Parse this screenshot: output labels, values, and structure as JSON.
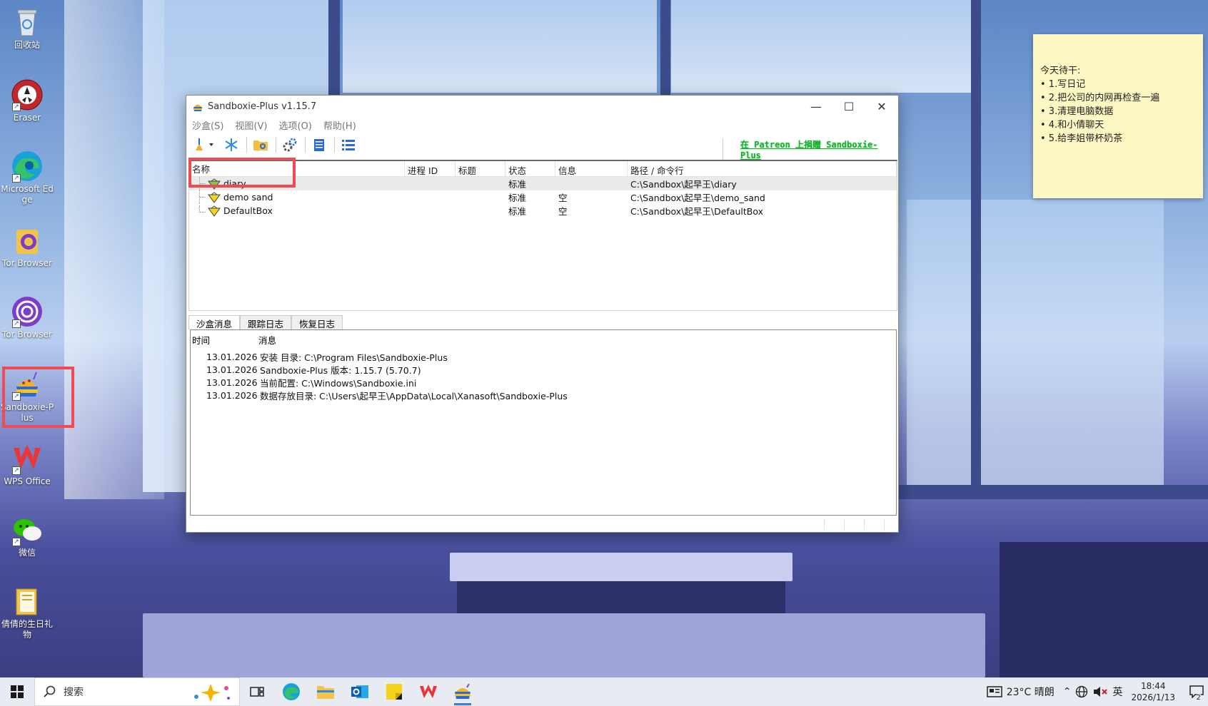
{
  "desktop": {
    "icons": [
      {
        "label": "回收站",
        "icon": "recycle-bin-icon"
      },
      {
        "label": "Eraser",
        "icon": "eraser-icon"
      },
      {
        "label": "Microsoft Edge",
        "icon": "edge-icon"
      },
      {
        "label": "Tor Browser",
        "icon": "tor-folder-icon"
      },
      {
        "label": "Tor Browser",
        "icon": "tor-browser-icon"
      },
      {
        "label": "Sandboxie-Plus",
        "icon": "sandboxie-icon"
      },
      {
        "label": "WPS Office",
        "icon": "wps-icon"
      },
      {
        "label": "微信",
        "icon": "wechat-icon"
      },
      {
        "label": "倩倩的生日礼物",
        "icon": "folder-icon"
      }
    ]
  },
  "sticky_note": {
    "title": "今天待干:",
    "items": [
      "• 1.写日记",
      "• 2.把公司的内网再检查一遍",
      "• 3.清理电脑数据",
      "• 4.和小倩聊天",
      "• 5.给李姐带杯奶茶"
    ]
  },
  "window": {
    "title": "Sandboxie-Plus v1.15.7",
    "menu": [
      "沙盒(S)",
      "视图(V)",
      "选项(O)",
      "帮助(H)"
    ],
    "patreon_link": "在 Patreon 上捐赠 Sandboxie-Plus",
    "columns": [
      "名称",
      "进程 ID",
      "标题",
      "状态",
      "信息",
      "路径 / 命令行"
    ],
    "boxes": [
      {
        "name": "diary",
        "pid": "",
        "title": "",
        "state": "标准",
        "info": "",
        "path": "C:\\Sandbox\\起早王\\diary",
        "color": "#8cc63f"
      },
      {
        "name": "demo sand",
        "pid": "",
        "title": "",
        "state": "标准",
        "info": "空",
        "path": "C:\\Sandbox\\起早王\\demo_sand",
        "color": "#f5d31a"
      },
      {
        "name": "DefaultBox",
        "pid": "",
        "title": "",
        "state": "标准",
        "info": "空",
        "path": "C:\\Sandbox\\起早王\\DefaultBox",
        "color": "#f5d31a"
      }
    ],
    "tabs": [
      "沙盒消息",
      "跟踪日志",
      "恢复日志"
    ],
    "log_columns": [
      "时间",
      "消息"
    ],
    "log": [
      {
        "time": "13.01.2026...",
        "msg": "安装 目录: C:\\Program Files\\Sandboxie-Plus"
      },
      {
        "time": "13.01.2026...",
        "msg": "Sandboxie-Plus 版本: 1.15.7 (5.70.7)"
      },
      {
        "time": "13.01.2026...",
        "msg": "当前配置: C:\\Windows\\Sandboxie.ini"
      },
      {
        "time": "13.01.2026...",
        "msg": "数据存放目录: C:\\Users\\起早王\\AppData\\Local\\Xanasoft\\Sandboxie-Plus"
      }
    ]
  },
  "taskbar": {
    "search_placeholder": "搜索",
    "weather": "23°C 晴朗",
    "ime": "英",
    "time": "18:44",
    "date": "2026/1/13",
    "notifications": "2"
  }
}
